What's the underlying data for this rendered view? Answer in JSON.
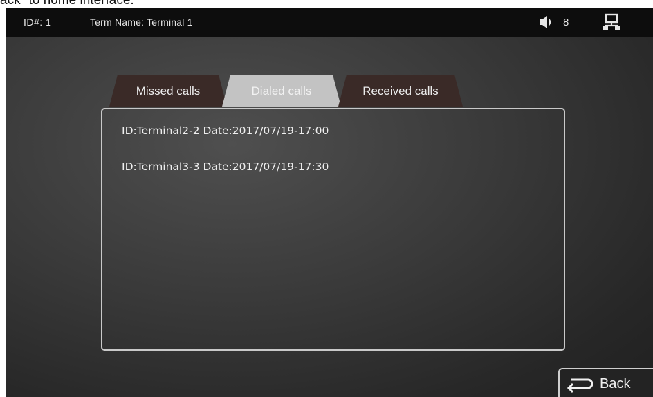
{
  "caption": "ack\" to home interface.",
  "statusbar": {
    "id_text": "ID#: 1",
    "term_text": "Term Name: Terminal 1",
    "volume_icon": "speaker-icon",
    "volume_level": "8",
    "network_icon": "network-icon"
  },
  "tabs": [
    {
      "label": "Missed calls",
      "selected": false
    },
    {
      "label": "Dialed calls",
      "selected": true
    },
    {
      "label": "Received calls",
      "selected": false
    }
  ],
  "calls": [
    {
      "text": "ID:Terminal2-2  Date:2017/07/19-17:00"
    },
    {
      "text": "ID:Terminal3-3  Date:2017/07/19-17:30"
    }
  ],
  "back_button": {
    "label": "Back",
    "icon": "return-arrow-icon"
  },
  "colors": {
    "status_bar": "#0d0d0d",
    "tab_normal": "#3a2a27",
    "tab_selected": "#c3c3c3",
    "panel_border": "#c9c9c9"
  }
}
